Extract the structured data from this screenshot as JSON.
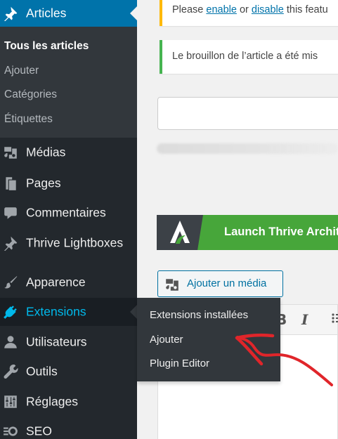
{
  "sidebar": {
    "articles": {
      "label": "Articles",
      "icon": "pushpin-icon"
    },
    "submenu": [
      "Tous les articles",
      "Ajouter",
      "Catégories",
      "Étiquettes"
    ],
    "items": [
      {
        "label": "Médias",
        "icon": "media-icon"
      },
      {
        "label": "Pages",
        "icon": "pages-icon"
      },
      {
        "label": "Commentaires",
        "icon": "comment-icon"
      },
      {
        "label": "Thrive Lightboxes",
        "icon": "pushpin-icon"
      },
      {
        "label": "Apparence",
        "icon": "paintbrush-icon"
      },
      {
        "label": "Extensions",
        "icon": "plugin-icon"
      },
      {
        "label": "Utilisateurs",
        "icon": "user-icon"
      },
      {
        "label": "Outils",
        "icon": "wrench-icon"
      },
      {
        "label": "Réglages",
        "icon": "settings-icon"
      },
      {
        "label": "SEO",
        "icon": "seo-icon"
      }
    ]
  },
  "flyout": [
    "Extensions installées",
    "Ajouter",
    "Plugin Editor"
  ],
  "notices": {
    "warning": {
      "before": "Please ",
      "link1": "enable",
      "middle": " or ",
      "link2": "disable",
      "after": " this featu"
    },
    "success": "Le brouillon de l’article a été mis"
  },
  "thrive_button": {
    "label": "Launch Thrive Archit"
  },
  "add_media_button": {
    "label": "Ajouter un média"
  },
  "toolbar": {
    "bold": "B",
    "italic": "I"
  },
  "colors": {
    "sidebar_bg": "#23282d",
    "submenu_bg": "#32373c",
    "active_blue": "#0073aa",
    "extensions_text": "#00b9eb",
    "thrive_green": "#47a63a",
    "warning_border": "#ffb900",
    "success_border": "#46b450",
    "annotation_red": "#e0252a"
  }
}
